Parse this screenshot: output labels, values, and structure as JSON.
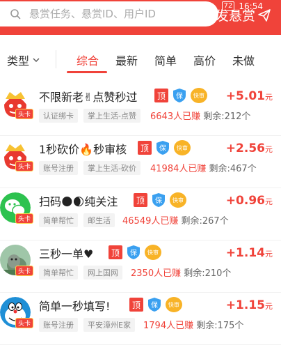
{
  "status": {
    "battery": "72",
    "time": "16:54"
  },
  "search": {
    "placeholder": "悬赏任务、悬赏ID、用户ID"
  },
  "header": {
    "publish_label": "发悬赏"
  },
  "filter": {
    "type_label": "类型"
  },
  "tabs": [
    {
      "label": "综合",
      "active": true
    },
    {
      "label": "最新"
    },
    {
      "label": "简单"
    },
    {
      "label": "高价"
    },
    {
      "label": "未做"
    }
  ],
  "badges": {
    "ding": "顶",
    "bao": "保",
    "fast": "快审"
  },
  "avatar_badge": "头卡",
  "tasks": [
    {
      "title": "不限新老✌点赞秒过",
      "tags": [
        "认证绑卡",
        "掌上生活-点赞"
      ],
      "earned": "6643人已赚",
      "remaining": "剩余:212个",
      "amount": "+5.01",
      "unit": "元",
      "avatar": "red"
    },
    {
      "title": "1秒砍价🔥秒审核",
      "tags": [
        "账号注册",
        "掌上生活-砍价"
      ],
      "earned": "41984人已赚",
      "remaining": "剩余:467个",
      "amount": "+2.56",
      "unit": "元",
      "avatar": "red"
    },
    {
      "title": "扫码🌑🌒纯关注",
      "tags": [
        "简单帮忙",
        "邮生活"
      ],
      "earned": "46549人已赚",
      "remaining": "剩余:267个",
      "amount": "+0.96",
      "unit": "元",
      "avatar": "green"
    },
    {
      "title": "三秒一单♥",
      "tags": [
        "简单帮忙",
        "网上国网"
      ],
      "earned": "2350人已赚",
      "remaining": "剩余:210个",
      "amount": "+1.14",
      "unit": "元",
      "avatar": "photo"
    },
    {
      "title": "简单一秒填写!",
      "tags": [
        "账号注册",
        "平安漳州E家"
      ],
      "earned": "1794人已赚",
      "remaining": "剩余:175个",
      "amount": "+1.15",
      "unit": "元",
      "avatar": "doraemon"
    }
  ]
}
